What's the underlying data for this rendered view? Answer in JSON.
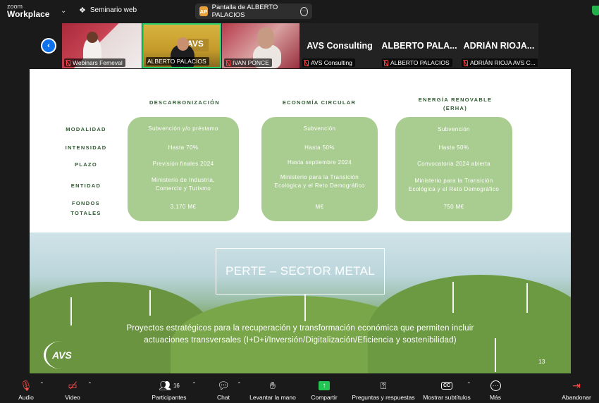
{
  "app": {
    "brand_top": "zoom",
    "brand_bottom": "Workplace",
    "webinar_label": "Seminario web"
  },
  "share_pill": {
    "badge": "AP",
    "label": "Pantalla de ALBERTO PALACIOS"
  },
  "gallery": {
    "tiles": [
      {
        "name": "Webinars Femeval",
        "muted": true
      },
      {
        "name": "ALBERTO PALACIOS",
        "muted": false,
        "active_speaker": true
      },
      {
        "name": "IVAN PONCE",
        "muted": true
      },
      {
        "big": "AVS Consulting",
        "name": "AVS Consulting",
        "muted": true
      },
      {
        "big": "ALBERTO PALA...",
        "name": "ALBERTO PALACIOS",
        "muted": true
      },
      {
        "big": "ADRIÁN RIOJA...",
        "name": "ADRIÁN RIOJA AVS C...",
        "muted": true
      }
    ]
  },
  "slide": {
    "columns": [
      "DESCARBONIZACIÓN",
      "ECONOMÍA CIRCULAR",
      "ENERGÍA RENOVABLE\n(ERHA)"
    ],
    "col1_head": "DESCARBONIZACIÓN",
    "col2_head": "ECONOMÍA CIRCULAR",
    "col3_head_l1": "ENERGÍA RENOVABLE",
    "col3_head_l2": "(ERHA)",
    "rows": [
      "MODALIDAD",
      "INTENSIDAD",
      "PLAZO",
      "ENTIDAD",
      "FONDOS",
      "TOTALES"
    ],
    "cards": [
      {
        "modalidad": "Subvención y/o préstamo",
        "intensidad": "Hasta 70%",
        "plazo": "Previsión finales 2024",
        "entidad_l1": "Ministerio de Industria,",
        "entidad_l2": "Comercio y Turismo",
        "fondos": "3.170 M€"
      },
      {
        "modalidad": "Subvención",
        "intensidad": "Hasta 50%",
        "plazo": "Hasta septiembre 2024",
        "entidad_l1": "Ministerio para la Transición",
        "entidad_l2": "Ecológica y el Reto Demográfico",
        "fondos_highlight": "    ",
        "fondos": " M€"
      },
      {
        "modalidad": "Subvención",
        "intensidad": "Hasta 50%",
        "plazo": "Convocatoria 2024 abierta",
        "entidad_l1": "Ministerio para la Transición",
        "entidad_l2": "Ecológica y el Reto Demográfico",
        "fondos": "750 M€"
      }
    ],
    "title": "PERTE – SECTOR METAL",
    "subtitle_l1": "Proyectos estratégicos para la recuperación y transformación económica que permiten incluir",
    "subtitle_l2": "actuaciones transversales (I+D+i/Inversión/Digitalización/Eficiencia y sostenibilidad)",
    "logo": "AVS",
    "page": "13"
  },
  "toolbar": {
    "audio": "Audio",
    "video": "Video",
    "participants": "Participantes",
    "participants_count": "16",
    "chat": "Chat",
    "raise_hand": "Levantar la mano",
    "share": "Compartir",
    "qa": "Preguntas y respuestas",
    "subtitles": "Mostrar subtítulos",
    "more": "Más",
    "leave": "Abandonar"
  },
  "colors": {
    "accent_green": "#a9cc90",
    "zoom_blue": "#0e72ed",
    "share_green": "#23c552",
    "muted_red": "#ff4a4a"
  }
}
